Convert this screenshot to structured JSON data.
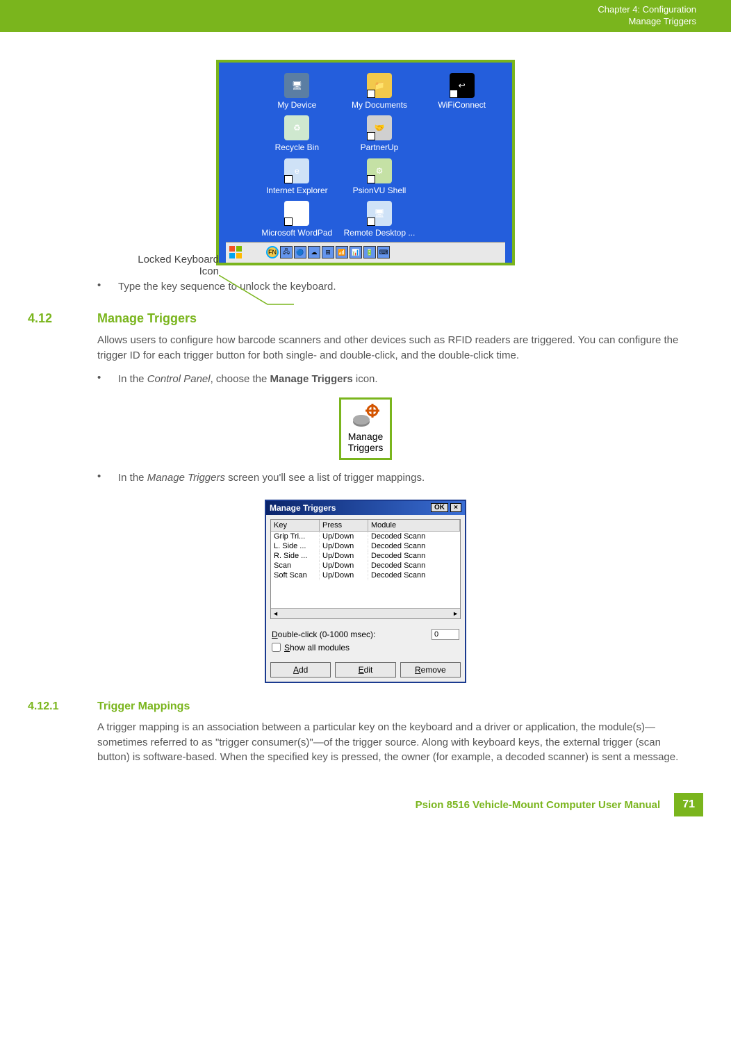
{
  "header": {
    "chapter": "Chapter 4:  Configuration",
    "section": "Manage Triggers"
  },
  "desktop": {
    "callout_label_l1": "Locked Keyboard",
    "callout_label_l2": "Icon",
    "icons": [
      {
        "label": "My Device",
        "glyph_bg": "#5b7ea3",
        "glyph": "🖥"
      },
      {
        "label": "My Documents",
        "glyph_bg": "#f2c94c",
        "glyph": "📁"
      },
      {
        "label": "WiFiConnect",
        "glyph_bg": "#000",
        "glyph": "↩"
      },
      {
        "label": "Recycle Bin",
        "glyph_bg": "#cfe8cf",
        "glyph": "♻"
      },
      {
        "label": "PartnerUp",
        "glyph_bg": "#d0d0d0",
        "glyph": "🤝"
      },
      {
        "label": "",
        "glyph_bg": "transparent",
        "glyph": ""
      },
      {
        "label": "Internet Explorer",
        "glyph_bg": "#cfe2f7",
        "glyph": "e"
      },
      {
        "label": "PsionVU Shell",
        "glyph_bg": "#c5e1a5",
        "glyph": "⚙"
      },
      {
        "label": "",
        "glyph_bg": "transparent",
        "glyph": ""
      },
      {
        "label": "Microsoft WordPad",
        "glyph_bg": "#fff",
        "glyph": "W"
      },
      {
        "label": "Remote Desktop ...",
        "glyph_bg": "#cfe2f7",
        "glyph": "🖥"
      }
    ],
    "taskbar_icons": [
      "FN",
      "🖧",
      "🔵",
      "☁",
      "⊞",
      "📶",
      "📊",
      "🔋",
      "⌨"
    ]
  },
  "bullet1": "Type the key sequence to unlock the keyboard.",
  "section412": {
    "num": "4.12",
    "title": "Manage Triggers",
    "intro": "Allows users to configure how barcode scanners and other devices such as RFID readers are triggered. You can configure the trigger ID for each trigger button for both single- and double-click, and the double-click time.",
    "bullet_a_pre": "In the ",
    "bullet_a_italic": "Control Panel",
    "bullet_a_mid": ", choose the ",
    "bullet_a_bold": "Manage Triggers",
    "bullet_a_post": " icon.",
    "mt_icon_l1": "Manage",
    "mt_icon_l2": "Triggers",
    "bullet_b_pre": "In the ",
    "bullet_b_italic": "Manage Triggers",
    "bullet_b_post": " screen you'll see a list of trigger mappings."
  },
  "mt_window": {
    "title": "Manage Triggers",
    "ok": "OK",
    "close": "×",
    "columns": {
      "key": "Key",
      "press": "Press",
      "module": "Module"
    },
    "rows": [
      {
        "key": "Grip Tri...",
        "press": "Up/Down",
        "module": "Decoded Scann"
      },
      {
        "key": "L. Side ...",
        "press": "Up/Down",
        "module": "Decoded Scann"
      },
      {
        "key": "R. Side ...",
        "press": "Up/Down",
        "module": "Decoded Scann"
      },
      {
        "key": "Scan",
        "press": "Up/Down",
        "module": "Decoded Scann"
      },
      {
        "key": "Soft Scan",
        "press": "Up/Down",
        "module": "Decoded Scann"
      }
    ],
    "dblclick_label": "Double-click (0-1000 msec):",
    "dblclick_value": "0",
    "show_all": "Show all modules",
    "add": "Add",
    "edit": "Edit",
    "remove": "Remove"
  },
  "section4121": {
    "num": "4.12.1",
    "title": "Trigger Mappings",
    "text": "A trigger mapping is an association between a particular key on the keyboard and a driver or application, the module(s)—sometimes referred to as \"trigger consumer(s)\"—of the trigger source. Along with keyboard keys, the external trigger (scan button) is software-based. When the specified key is pressed, the owner (for example, a decoded scanner) is sent a message."
  },
  "footer": {
    "title": "Psion 8516 Vehicle-Mount Computer User Manual",
    "page": "71"
  }
}
